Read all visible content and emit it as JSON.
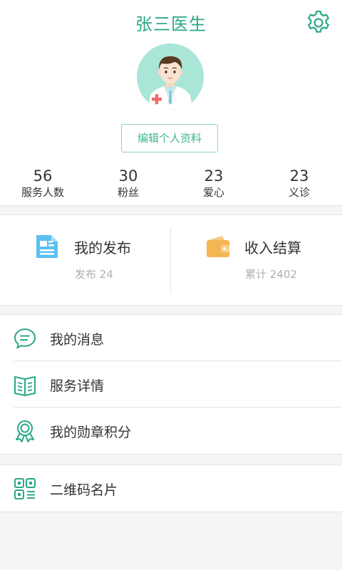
{
  "header": {
    "title": "张三医生",
    "edit_profile_label": "编辑个人资料"
  },
  "stats": [
    {
      "value": "56",
      "label": "服务人数"
    },
    {
      "value": "30",
      "label": "粉丝"
    },
    {
      "value": "23",
      "label": "爱心"
    },
    {
      "value": "23",
      "label": "义诊"
    }
  ],
  "quick": {
    "publish": {
      "label": "我的发布",
      "sub": "发布 24",
      "icon": "document-icon"
    },
    "income": {
      "label": "收入结算",
      "sub": "累计 2402",
      "icon": "wallet-icon"
    }
  },
  "menu": [
    {
      "label": "我的消息",
      "icon": "chat-bubble-icon"
    },
    {
      "label": "服务详情",
      "icon": "book-icon"
    },
    {
      "label": "我的勋章积分",
      "icon": "medal-icon"
    }
  ],
  "menu2": [
    {
      "label": "二维码名片",
      "icon": "qr-code-icon"
    }
  ],
  "colors": {
    "accent": "#2aa887",
    "publish_icon": "#5bc0f0",
    "wallet_icon": "#f5b554"
  }
}
